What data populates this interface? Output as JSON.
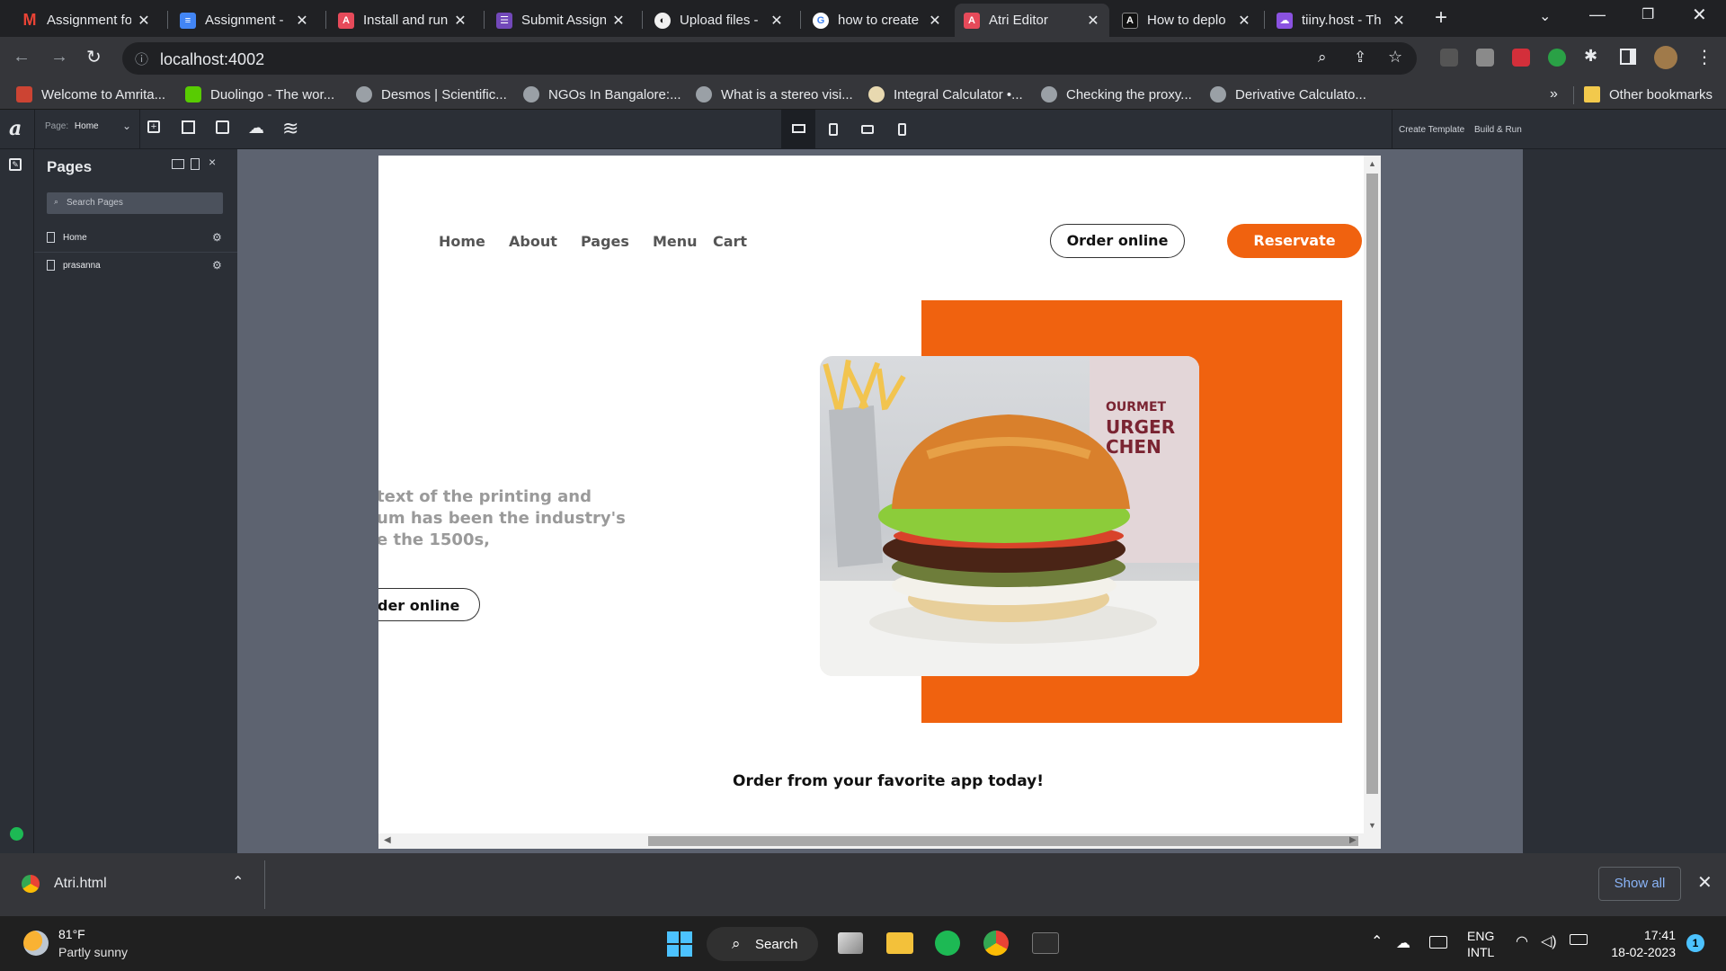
{
  "tabs": [
    {
      "title": "Assignment fo",
      "icon": "gmail-icon",
      "color": "#ea4335"
    },
    {
      "title": "Assignment - ",
      "icon": "docs-icon",
      "color": "#4285f4"
    },
    {
      "title": "Install and run",
      "icon": "atri-icon",
      "color": "#e64a5a"
    },
    {
      "title": "Submit Assign",
      "icon": "forms-icon",
      "color": "#7248b9"
    },
    {
      "title": "Upload files - ",
      "icon": "github-icon",
      "color": "#f0f0f0"
    },
    {
      "title": "how to create",
      "icon": "google-icon",
      "color": "#ffffff"
    },
    {
      "title": "Atri Editor",
      "icon": "atri-icon",
      "color": "#e64a5a"
    },
    {
      "title": "How to deplo",
      "icon": "astro-icon",
      "color": "#111111"
    },
    {
      "title": "tiiny.host - Th",
      "icon": "tiiny-icon",
      "color": "#8a52e0"
    }
  ],
  "browser": {
    "url": "localhost:4002"
  },
  "bookmarks": [
    "Welcome to Amrita...",
    "Duolingo - The wor...",
    "Desmos | Scientific...",
    "NGOs In Bangalore:...",
    "What is a stereo visi...",
    "Integral Calculator •...",
    "Checking the proxy...",
    "Derivative Calculato..."
  ],
  "bookmarks_more": "»",
  "other_bookmarks": "Other bookmarks",
  "editor": {
    "page_label": "Page:",
    "page_value": "Home",
    "create_template": "Create Template",
    "build_run": "Build & Run",
    "logo": "a"
  },
  "pages_panel": {
    "title": "Pages",
    "search_placeholder": "Search Pages",
    "items": [
      "Home",
      "prasanna"
    ]
  },
  "site": {
    "nav": [
      "Home",
      "About",
      "Pages",
      "Menu",
      "Cart"
    ],
    "order_online": "Order online",
    "reservate": "Reservate",
    "hero_text_lines": [
      "text of the printing and",
      "um has been the industry's",
      "e the 1500s,"
    ],
    "hero_button": "der online",
    "footer_line": "Order from your favorite app today!",
    "accent": "#f0620f",
    "burger_sign": [
      "OURMET",
      "URGER",
      "CHEN"
    ]
  },
  "download": {
    "file": "Atri.html",
    "show_all": "Show all"
  },
  "taskbar": {
    "temp": "81°F",
    "weather": "Partly sunny",
    "search": "Search",
    "lang1": "ENG",
    "lang2": "INTL",
    "time": "17:41",
    "date": "18-02-2023",
    "notif": "1"
  }
}
